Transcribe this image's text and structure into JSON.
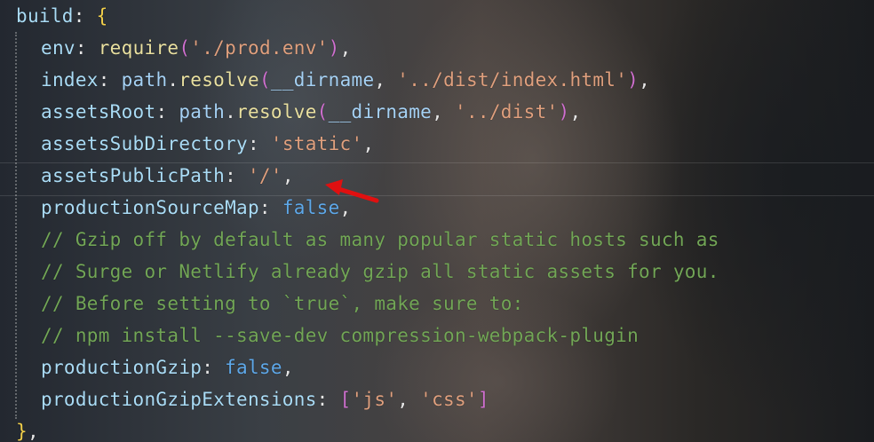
{
  "code": {
    "lines": [
      [
        {
          "t": "build",
          "c": "k"
        },
        {
          "t": ": ",
          "c": "p"
        },
        {
          "t": "{",
          "c": "br"
        }
      ],
      [
        {
          "t": "env",
          "c": "k"
        },
        {
          "t": ": ",
          "c": "p"
        },
        {
          "t": "require",
          "c": "f"
        },
        {
          "t": "(",
          "c": "br2"
        },
        {
          "t": "'./prod.env'",
          "c": "s"
        },
        {
          "t": ")",
          "c": "br2"
        },
        {
          "t": ",",
          "c": "p"
        }
      ],
      [
        {
          "t": "index",
          "c": "k"
        },
        {
          "t": ": ",
          "c": "p"
        },
        {
          "t": "path",
          "c": "v"
        },
        {
          "t": ".",
          "c": "p"
        },
        {
          "t": "resolve",
          "c": "f"
        },
        {
          "t": "(",
          "c": "br2"
        },
        {
          "t": "__dirname",
          "c": "v"
        },
        {
          "t": ", ",
          "c": "p"
        },
        {
          "t": "'../dist/index.html'",
          "c": "s"
        },
        {
          "t": ")",
          "c": "br2"
        },
        {
          "t": ",",
          "c": "p"
        }
      ],
      [
        {
          "t": "assetsRoot",
          "c": "k"
        },
        {
          "t": ": ",
          "c": "p"
        },
        {
          "t": "path",
          "c": "v"
        },
        {
          "t": ".",
          "c": "p"
        },
        {
          "t": "resolve",
          "c": "f"
        },
        {
          "t": "(",
          "c": "br2"
        },
        {
          "t": "__dirname",
          "c": "v"
        },
        {
          "t": ", ",
          "c": "p"
        },
        {
          "t": "'../dist'",
          "c": "s"
        },
        {
          "t": ")",
          "c": "br2"
        },
        {
          "t": ",",
          "c": "p"
        }
      ],
      [
        {
          "t": "assetsSubDirectory",
          "c": "k"
        },
        {
          "t": ": ",
          "c": "p"
        },
        {
          "t": "'static'",
          "c": "s"
        },
        {
          "t": ",",
          "c": "p"
        }
      ],
      [
        {
          "t": "assetsPublicPath",
          "c": "k"
        },
        {
          "t": ": ",
          "c": "p"
        },
        {
          "t": "'/'",
          "c": "s"
        },
        {
          "t": ",",
          "c": "p"
        }
      ],
      [
        {
          "t": "productionSourceMap",
          "c": "k"
        },
        {
          "t": ": ",
          "c": "p"
        },
        {
          "t": "false",
          "c": "b"
        },
        {
          "t": ",",
          "c": "p"
        }
      ],
      [
        {
          "t": "// Gzip off by default as many popular static hosts such as",
          "c": "c"
        }
      ],
      [
        {
          "t": "// Surge or Netlify already gzip all static assets for you.",
          "c": "c"
        }
      ],
      [
        {
          "t": "// Before setting to `true`, make sure to:",
          "c": "c"
        }
      ],
      [
        {
          "t": "// npm install --save-dev compression-webpack-plugin",
          "c": "c"
        }
      ],
      [
        {
          "t": "productionGzip",
          "c": "k"
        },
        {
          "t": ": ",
          "c": "p"
        },
        {
          "t": "false",
          "c": "b"
        },
        {
          "t": ",",
          "c": "p"
        }
      ],
      [
        {
          "t": "productionGzipExtensions",
          "c": "k"
        },
        {
          "t": ": ",
          "c": "p"
        },
        {
          "t": "[",
          "c": "br2"
        },
        {
          "t": "'js'",
          "c": "s"
        },
        {
          "t": ", ",
          "c": "p"
        },
        {
          "t": "'css'",
          "c": "s"
        },
        {
          "t": "]",
          "c": "br2"
        }
      ],
      [
        {
          "t": "}",
          "c": "br"
        },
        {
          "t": ",",
          "c": "p"
        }
      ]
    ],
    "highlighted_line": 5
  },
  "colors": {
    "background": "#1e2228",
    "arrow": "#e01010"
  },
  "annotation": {
    "icon": "red-arrow-icon"
  }
}
